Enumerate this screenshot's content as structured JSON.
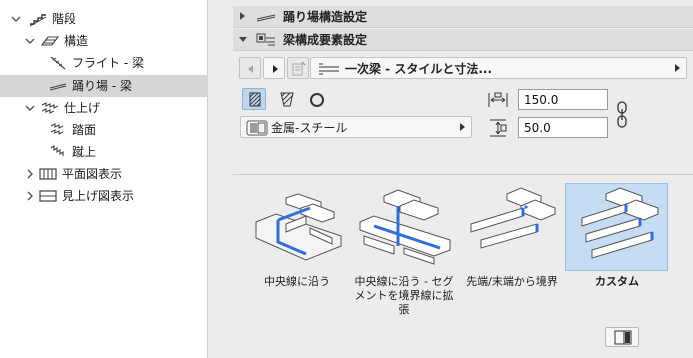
{
  "tree": {
    "items": [
      {
        "label": "階段",
        "icon": "stair-icon",
        "expanded": true,
        "selected": false
      },
      {
        "label": "構造",
        "icon": "structure-icon",
        "expanded": true,
        "selected": false
      },
      {
        "label": "フライト - 梁",
        "icon": "flight-beam-icon",
        "selected": false
      },
      {
        "label": "踊り場 - 梁",
        "icon": "landing-beam-icon",
        "selected": true
      },
      {
        "label": "仕上げ",
        "icon": "finish-icon",
        "expanded": true,
        "selected": false
      },
      {
        "label": "踏面",
        "icon": "tread-icon",
        "selected": false
      },
      {
        "label": "蹴上",
        "icon": "riser-icon",
        "selected": false
      },
      {
        "label": "平面図表示",
        "icon": "floor-plan-icon",
        "expanded": false,
        "selected": false
      },
      {
        "label": "見上げ図表示",
        "icon": "ceiling-plan-icon",
        "expanded": false,
        "selected": false
      }
    ]
  },
  "sections": {
    "landing_structure": {
      "title": "踊り場構造設定",
      "expanded": false
    },
    "beam_components": {
      "title": "梁構成要素設定",
      "expanded": true
    }
  },
  "toolbar": {
    "style_label": "一次梁 - スタイルと寸法..."
  },
  "material": {
    "label": "金属-スチール"
  },
  "dimensions": {
    "width": "150.0",
    "height": "50.0"
  },
  "options": [
    {
      "caption_lines": [
        "中央線に沿う"
      ],
      "selected": false
    },
    {
      "caption_lines": [
        "中央線に沿う - セグ",
        "メントを境界線に拡",
        "張"
      ],
      "selected": false
    },
    {
      "caption_lines": [
        "先端/末端から境界"
      ],
      "selected": false
    },
    {
      "caption_lines": [
        "カスタム"
      ],
      "selected": true
    }
  ],
  "colors": {
    "selection_blue": "#c6dcf2",
    "beam_highlight": "#2f6fd6"
  }
}
